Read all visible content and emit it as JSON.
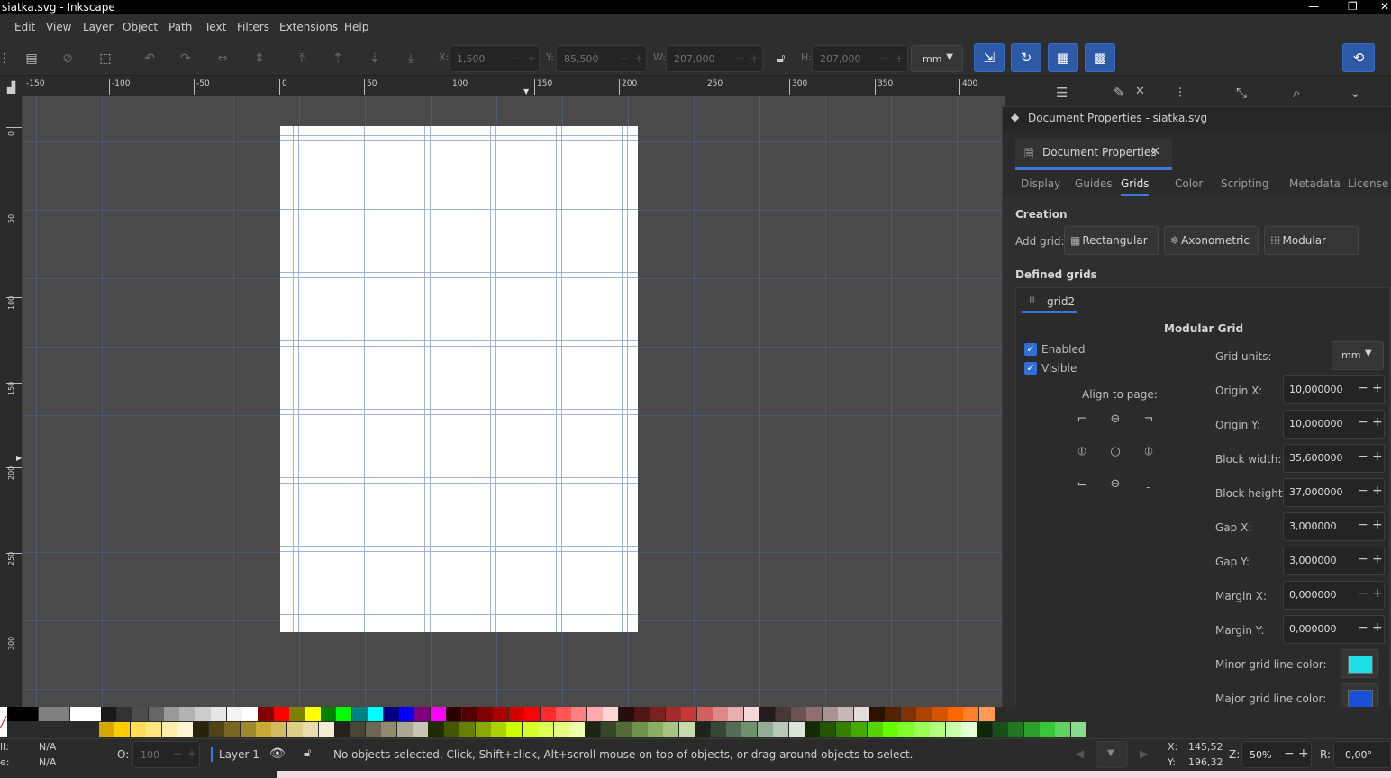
{
  "window": {
    "title": "siatka.svg - Inkscape",
    "controls": [
      "—",
      "❐",
      "✕"
    ]
  },
  "menubar": [
    "Edit",
    "View",
    "Layer",
    "Object",
    "Path",
    "Text",
    "Filters",
    "Extensions",
    "Help"
  ],
  "toolbar": {
    "x_label": "X:",
    "x_value": "1,500",
    "y_label": "Y:",
    "y_value": "85,500",
    "w_label": "W:",
    "w_value": "207,000",
    "h_label": "H:",
    "h_value": "207,000",
    "unit": "mm"
  },
  "ruler": {
    "h_labels": [
      "-150",
      "-100",
      "-50",
      "0",
      "50",
      "100",
      "150",
      "200",
      "250",
      "300",
      "350",
      "400"
    ],
    "v_labels": [
      "0",
      "50",
      "100",
      "150",
      "200",
      "250",
      "300"
    ]
  },
  "dialog": {
    "window_title": "Document Properties - siatka.svg",
    "tab_label": "Document Properties",
    "subtabs": [
      "Display",
      "Guides",
      "Grids",
      "Color",
      "Scripting",
      "Metadata",
      "License"
    ],
    "active_subtab": "Grids",
    "creation_heading": "Creation",
    "add_grid_label": "Add grid:",
    "add_buttons": [
      "Rectangular",
      "Axonometric",
      "Modular"
    ],
    "defined_heading": "Defined grids",
    "grid_tab": "grid2",
    "grid_type_title": "Modular Grid",
    "enabled_label": "Enabled",
    "visible_label": "Visible",
    "align_label": "Align to page:",
    "grid_units_label": "Grid units:",
    "grid_units_value": "mm",
    "fields": [
      {
        "label": "Origin X:",
        "value": "10,000000"
      },
      {
        "label": "Origin Y:",
        "value": "10,000000"
      },
      {
        "label": "Block width:",
        "value": "35,600000"
      },
      {
        "label": "Block height:",
        "value": "37,000000"
      },
      {
        "label": "Gap X:",
        "value": "3,000000"
      },
      {
        "label": "Gap Y:",
        "value": "3,000000"
      },
      {
        "label": "Margin X:",
        "value": "0,000000"
      },
      {
        "label": "Margin Y:",
        "value": "0,000000"
      }
    ],
    "minor_color_label": "Minor grid line color:",
    "major_color_label": "Major grid line color:",
    "minor_color": "#1ee0e8",
    "major_color": "#1a4fd8"
  },
  "statusbar": {
    "fill_label": "ll:",
    "fill_value": "N/A",
    "stroke_label": "e:",
    "stroke_value": "N/A",
    "opacity_label": "O:",
    "opacity_value": "100",
    "layer": "Layer 1",
    "message": "No objects selected. Click, Shift+click, Alt+scroll mouse on top of objects, or drag around objects to select.",
    "cursor_x_label": "X:",
    "cursor_x": "145,52",
    "cursor_y_label": "Y:",
    "cursor_y": "196,32",
    "zoom_label": "Z:",
    "zoom": "50%",
    "rotate_label": "R:",
    "rotate": "0,00°"
  },
  "colors": {
    "accent": "#2f6fd6",
    "canvas": "#4a4a4a",
    "page": "#ffffff",
    "palette_row1": [
      "#000000",
      "#000000",
      "#808080",
      "#808080",
      "#ffffff",
      "#ffffff",
      "#1a1a1a",
      "#333333",
      "#4d4d4d",
      "#666666",
      "#999999",
      "#b3b3b3",
      "#cccccc",
      "#e6e6e6",
      "#f2f2f2",
      "#ffffff",
      "#800000",
      "#ff0000",
      "#808000",
      "#ffff00",
      "#008000",
      "#00ff00",
      "#008080",
      "#00ffff",
      "#000080",
      "#0000ff",
      "#800080",
      "#ff00ff",
      "#2b0000",
      "#550000",
      "#800000",
      "#aa0000",
      "#d40000",
      "#ff0000",
      "#ff2a2a",
      "#ff5555",
      "#ff8080",
      "#ffaaaa",
      "#ffd5d5",
      "#280b0b",
      "#501616",
      "#782121",
      "#a02c2c",
      "#c83737",
      "#d35f5f",
      "#de8787",
      "#e9afaf",
      "#f4d7d7",
      "#241c1c",
      "#483737",
      "#6c5353",
      "#916f6f",
      "#ac9393",
      "#c8b7b7",
      "#e3dbdb",
      "#2b1100",
      "#552200",
      "#803300",
      "#aa4400",
      "#d45500",
      "#ff6600",
      "#ff7f2a",
      "#ff9955"
    ],
    "palette_row2": [
      "#d4aa00",
      "#ffcc00",
      "#ffdd55",
      "#ffe680",
      "#ffeeaa",
      "#fff6d5",
      "#28220b",
      "#504416",
      "#786721",
      "#a0892c",
      "#c8ab37",
      "#d3bc5f",
      "#decd87",
      "#e9ddaf",
      "#f4eed7",
      "#24221c",
      "#484537",
      "#6c6753",
      "#918a6f",
      "#aca793",
      "#c8c4b7",
      "#222b00",
      "#445500",
      "#668000",
      "#88aa00",
      "#aad400",
      "#ccff00",
      "#d4ff2a",
      "#ddff55",
      "#e5ff80",
      "#eeffaa",
      "#1c2412",
      "#374824",
      "#536c36",
      "#6f9148",
      "#8aad60",
      "#a7c386",
      "#c5d9ab",
      "#1c241c",
      "#374837",
      "#536c53",
      "#6f916f",
      "#93ac93",
      "#b7c8b7",
      "#dbe3db",
      "#112b00",
      "#225500",
      "#338000",
      "#44aa00",
      "#55d400",
      "#66ff00",
      "#7fff2a",
      "#99ff55",
      "#b3ff80",
      "#ccffaa",
      "#e5ffd5",
      "#0b280b",
      "#165016",
      "#217821",
      "#2ca02c",
      "#37c837",
      "#5fd35f",
      "#87de87"
    ]
  }
}
